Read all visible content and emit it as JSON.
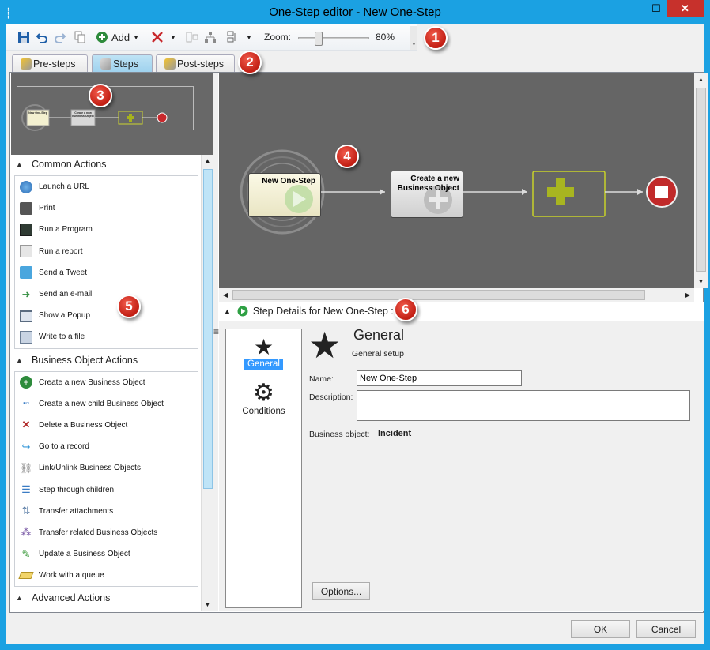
{
  "window": {
    "title": "One-Step editor - New One-Step",
    "min_glyph": "‒",
    "max_glyph": "☐",
    "close_glyph": "✕"
  },
  "toolbar": {
    "add_label": "Add",
    "zoom_label": "Zoom:",
    "zoom_value": "80%",
    "zoom_level": 0.8
  },
  "callouts": [
    "1",
    "2",
    "3",
    "4",
    "5",
    "6"
  ],
  "tabs": [
    {
      "label": "Pre-steps",
      "active": false
    },
    {
      "label": "Steps",
      "active": true
    },
    {
      "label": "Post-steps",
      "active": false
    }
  ],
  "thumbnail": {
    "node1": "New One-Step",
    "node2": "Create a new Business Object"
  },
  "canvas": {
    "node1_label": "New One-Step",
    "node2_label": "Create a new Business Object"
  },
  "accordion": {
    "common": {
      "title": "Common Actions",
      "items": [
        "Launch a URL",
        "Print",
        "Run a Program",
        "Run a report",
        "Send a Tweet",
        "Send an e-mail",
        "Show a Popup",
        "Write to a file"
      ]
    },
    "business": {
      "title": "Business Object Actions",
      "items": [
        "Create a new Business Object",
        "Create a new child Business Object",
        "Delete a Business Object",
        "Go to a record",
        "Link/Unlink Business Objects",
        "Step through children",
        "Transfer attachments",
        "Transfer related Business Objects",
        "Update a Business Object",
        "Work with a queue"
      ]
    },
    "advanced": {
      "title": "Advanced Actions"
    }
  },
  "step_details": {
    "header": "Step Details for New One-Step :",
    "nav": [
      {
        "label": "General"
      },
      {
        "label": "Conditions"
      }
    ],
    "section_title": "General",
    "section_subtitle": "General setup",
    "name_label": "Name:",
    "name_value": "New One-Step",
    "description_label": "Description:",
    "description_value": "",
    "bo_label": "Business object:",
    "bo_value": "Incident",
    "options_button": "Options..."
  },
  "footer": {
    "ok": "OK",
    "cancel": "Cancel"
  },
  "colors": {
    "titlebar": "#1ba1e2",
    "canvas": "#656565",
    "close": "#c7312c",
    "badge": "#d9332a",
    "accent": "#3399ff"
  }
}
